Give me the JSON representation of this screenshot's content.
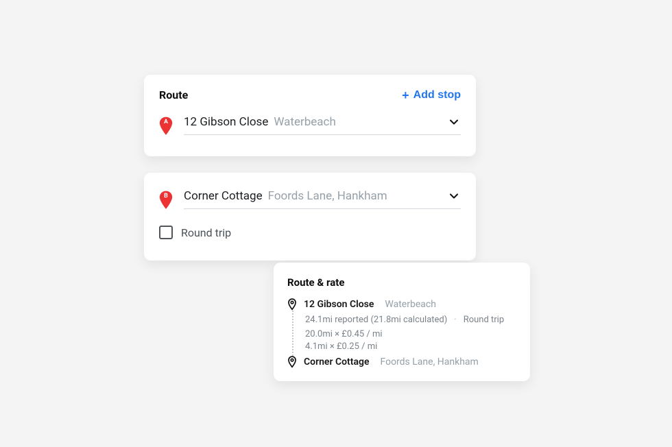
{
  "card1": {
    "title": "Route",
    "add_label": "Add stop",
    "stopA": {
      "letter": "A",
      "primary": "12 Gibson Close",
      "secondary": "Waterbeach"
    }
  },
  "card2": {
    "stopB": {
      "letter": "B",
      "primary": "Corner Cottage",
      "secondary": "Foords Lane, Hankham"
    },
    "roundtrip_label": "Round trip"
  },
  "card3": {
    "title": "Route & rate",
    "from": {
      "primary": "12 Gibson Close",
      "secondary": "Waterbeach"
    },
    "reported_line": "24.1mi reported (21.8mi calculated)",
    "roundtrip_flag": "Round trip",
    "rate1": "20.0mi × £0.45 / mi",
    "rate2": "4.1mi × £0.25 / mi",
    "to": {
      "primary": "Corner Cottage",
      "secondary": "Foords Lane, Hankham"
    }
  }
}
